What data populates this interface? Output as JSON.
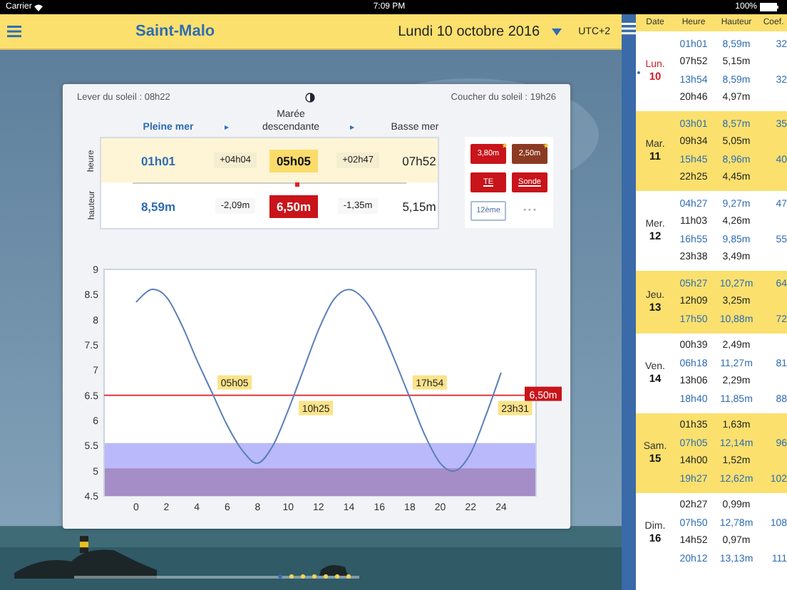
{
  "status_bar": {
    "carrier": "Carrier",
    "time": "7:09 PM",
    "battery": "100%"
  },
  "header": {
    "title": "Saint-Malo",
    "date": "Lundi 10 octobre 2016",
    "timezone": "UTC+2"
  },
  "sun": {
    "sunrise": "Lever du soleil : 08h22",
    "sunset": "Coucher du soleil : 19h26"
  },
  "tide_table": {
    "row_labels": [
      "heure",
      "hauteur"
    ],
    "progress": {
      "level": 0.6
    },
    "columns": [
      {
        "heading": "Pleine mer",
        "time": "01h01",
        "height": "8,59m",
        "kind": "high"
      },
      {
        "heading": "▸",
        "time": "+04h04",
        "height": "-2,09m",
        "kind": "interval"
      },
      {
        "heading": "Marée descendante",
        "time": "05h05",
        "height": "6,50m",
        "kind": "current"
      },
      {
        "heading": "▸",
        "time": "+02h47",
        "height": "-1,35m",
        "kind": "interval"
      },
      {
        "heading": "Basse mer",
        "time": "07h52",
        "height": "5,15m",
        "kind": "low"
      }
    ]
  },
  "tools": [
    {
      "label": "3,80m",
      "kind": "red",
      "starred": true
    },
    {
      "label": "2,50m",
      "kind": "brown",
      "starred": true
    },
    {
      "label": "TE",
      "kind": "link",
      "starred": false
    },
    {
      "label": "Sonde",
      "kind": "link",
      "starred": false
    },
    {
      "label": "12ème",
      "kind": "outline",
      "starred": false
    },
    {
      "label": "• • •",
      "kind": "more",
      "starred": false
    }
  ],
  "chart": {
    "chart_data": {
      "type": "line",
      "x": [
        0,
        1,
        2,
        3,
        4,
        5,
        6,
        7,
        8,
        9,
        10,
        11,
        12,
        13,
        14,
        15,
        16,
        17,
        18,
        19,
        20,
        21,
        22,
        23,
        24
      ],
      "series": [
        {
          "color": "#5a7fb8",
          "values": [
            8.35,
            8.6,
            8.45,
            7.9,
            7.2,
            6.55,
            5.9,
            5.4,
            5.15,
            5.5,
            6.2,
            7.0,
            7.8,
            8.4,
            8.6,
            8.4,
            7.9,
            7.2,
            6.45,
            5.7,
            5.15,
            5.0,
            5.35,
            6.1,
            6.95
          ]
        }
      ],
      "xticks": [
        0,
        2,
        4,
        6,
        8,
        10,
        12,
        14,
        16,
        18,
        20,
        22,
        24
      ],
      "yticks": [
        {
          "value": 4.5,
          "label": "4.5"
        },
        {
          "value": 5,
          "label": "5"
        },
        {
          "value": 5.5,
          "label": "5.5"
        },
        {
          "value": 6,
          "label": "6"
        },
        {
          "value": 6.5,
          "label": "6.5"
        },
        {
          "value": 7,
          "label": "7"
        },
        {
          "value": 7.5,
          "label": "7.5"
        },
        {
          "value": 8,
          "label": "8"
        },
        {
          "value": 8.5,
          "label": "8.5"
        },
        {
          "value": 9,
          "label": "9"
        }
      ],
      "xlim": [
        -2.1,
        26.3
      ],
      "ylim": [
        4.5,
        9
      ],
      "bands": [
        {
          "axis": "y",
          "from": 5.05,
          "to": 5.55,
          "color": "#b9b9fb"
        },
        {
          "axis": "y",
          "from": 4.5,
          "to": 5.05,
          "color": "#a58dc8"
        }
      ],
      "ref_lines": [
        {
          "axis": "y",
          "value": 6.5,
          "label": "6,50m",
          "color": "#e0373d"
        }
      ],
      "annotations": [
        {
          "x": 5.08,
          "y": 6.5,
          "text": "05h05"
        },
        {
          "x": 10.42,
          "y": 6.5,
          "text": "10h25"
        },
        {
          "x": 17.9,
          "y": 6.5,
          "text": "17h54"
        },
        {
          "x": 23.52,
          "y": 6.5,
          "text": "23h31"
        }
      ]
    }
  },
  "pager": [
    {
      "selected": true
    },
    {
      "selected": false
    },
    {
      "selected": false
    },
    {
      "selected": false
    },
    {
      "selected": false
    },
    {
      "selected": false
    },
    {
      "selected": false
    }
  ],
  "sidebar": {
    "columns": [
      "Date",
      "Heure",
      "Hauteur",
      "Coef."
    ],
    "days": [
      {
        "weekday": "Lun.",
        "day": "10",
        "selected": true,
        "tides": [
          {
            "time": "01h01",
            "height": "8,59m",
            "coef": "32",
            "kind": "high"
          },
          {
            "time": "07h52",
            "height": "5,15m",
            "kind": "low"
          },
          {
            "time": "13h54",
            "height": "8,59m",
            "coef": "32",
            "kind": "high"
          },
          {
            "time": "20h46",
            "height": "4,97m",
            "kind": "low"
          }
        ]
      },
      {
        "weekday": "Mar.",
        "day": "11",
        "selected": false,
        "tides": [
          {
            "time": "03h01",
            "height": "8,57m",
            "coef": "35",
            "kind": "high"
          },
          {
            "time": "09h34",
            "height": "5,05m",
            "kind": "low"
          },
          {
            "time": "15h45",
            "height": "8,96m",
            "coef": "40",
            "kind": "high"
          },
          {
            "time": "22h25",
            "height": "4,45m",
            "kind": "low"
          }
        ]
      },
      {
        "weekday": "Mer.",
        "day": "12",
        "selected": false,
        "tides": [
          {
            "time": "04h27",
            "height": "9,27m",
            "coef": "47",
            "kind": "high"
          },
          {
            "time": "11h03",
            "height": "4,26m",
            "kind": "low"
          },
          {
            "time": "16h55",
            "height": "9,85m",
            "coef": "55",
            "kind": "high"
          },
          {
            "time": "23h38",
            "height": "3,49m",
            "kind": "low"
          }
        ]
      },
      {
        "weekday": "Jeu.",
        "day": "13",
        "selected": false,
        "tides": [
          {
            "time": "05h27",
            "height": "10,27m",
            "coef": "64",
            "kind": "high"
          },
          {
            "time": "12h09",
            "height": "3,25m",
            "kind": "low"
          },
          {
            "time": "17h50",
            "height": "10,88m",
            "coef": "72",
            "kind": "high"
          }
        ]
      },
      {
        "weekday": "Ven.",
        "day": "14",
        "selected": false,
        "tides": [
          {
            "time": "00h39",
            "height": "2,49m",
            "kind": "low"
          },
          {
            "time": "06h18",
            "height": "11,27m",
            "coef": "81",
            "kind": "high"
          },
          {
            "time": "13h06",
            "height": "2,29m",
            "kind": "low"
          },
          {
            "time": "18h40",
            "height": "11,85m",
            "coef": "88",
            "kind": "high"
          }
        ]
      },
      {
        "weekday": "Sam.",
        "day": "15",
        "selected": false,
        "tides": [
          {
            "time": "01h35",
            "height": "1,63m",
            "kind": "low"
          },
          {
            "time": "07h05",
            "height": "12,14m",
            "coef": "96",
            "kind": "high"
          },
          {
            "time": "14h00",
            "height": "1,52m",
            "kind": "low"
          },
          {
            "time": "19h27",
            "height": "12,62m",
            "coef": "102",
            "kind": "high"
          }
        ]
      },
      {
        "weekday": "Dim.",
        "day": "16",
        "selected": false,
        "tides": [
          {
            "time": "02h27",
            "height": "0,99m",
            "kind": "low"
          },
          {
            "time": "07h50",
            "height": "12,78m",
            "coef": "108",
            "kind": "high"
          },
          {
            "time": "14h52",
            "height": "0,97m",
            "kind": "low"
          },
          {
            "time": "20h12",
            "height": "13,13m",
            "coef": "111",
            "kind": "high"
          }
        ]
      }
    ]
  }
}
